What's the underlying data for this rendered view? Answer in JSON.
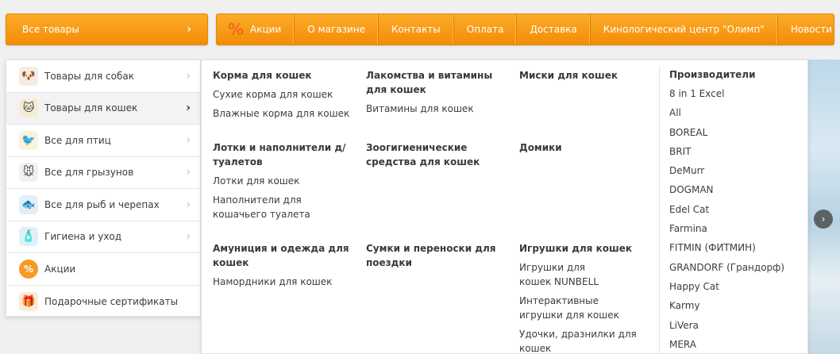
{
  "all_goods": {
    "label": "Все товары",
    "chevron": "›"
  },
  "topnav": {
    "percent_icon": "%",
    "items": [
      "Акции",
      "О магазине",
      "Контакты",
      "Оплата",
      "Доставка",
      "Кинологический центр \"Олимп\"",
      "Новости"
    ]
  },
  "sidebar": {
    "items": [
      {
        "label": "Товары для собак",
        "icon": "dog-icon",
        "glyph": "🐶"
      },
      {
        "label": "Товары для кошек",
        "icon": "cat-icon",
        "glyph": "🐱"
      },
      {
        "label": "Все для птиц",
        "icon": "bird-icon",
        "glyph": "🐦"
      },
      {
        "label": "Все для грызунов",
        "icon": "rodent-icon",
        "glyph": "🐭"
      },
      {
        "label": "Все для рыб и черепах",
        "icon": "fish-icon",
        "glyph": "🐟"
      },
      {
        "label": "Гигиена и уход",
        "icon": "shampoo-icon",
        "glyph": "🧴"
      },
      {
        "label": "Акции",
        "icon": "percent-icon",
        "glyph": "%"
      },
      {
        "label": "Подарочные сертификаты",
        "icon": "gift-certificate-icon",
        "glyph": "🎁"
      }
    ],
    "chevron": "›"
  },
  "mega": {
    "col1": {
      "g1": {
        "title": "Корма для кошек",
        "links": [
          "Сухие корма для кошек",
          "Влажные корма для кошек"
        ]
      },
      "g2": {
        "title": "Лотки и наполнители д/ туалетов",
        "links": [
          "Лотки для кошек",
          "Наполнители для кошачьего туалета"
        ]
      },
      "g3": {
        "title": "Амуниция и одежда для кошек",
        "links": [
          "Намордники для кошек"
        ]
      }
    },
    "col2": {
      "g1": {
        "title": "Лакомства и витамины для кошек",
        "links": [
          "Витамины для кошек"
        ]
      },
      "g2": {
        "title": "Зоогигиенические средства для кошек"
      },
      "g3": {
        "title": "Сумки и переноски для поездки"
      }
    },
    "col3": {
      "g1": {
        "title": "Миски для кошек"
      },
      "g2": {
        "title": "Домики"
      },
      "g3": {
        "title": "Игрушки для кошек",
        "links": [
          "Игрушки для кошек NUNBELL",
          "Интерактивные игрушки для кошек",
          "Удочки, дразнилки для кошек"
        ]
      }
    },
    "brands": {
      "title": "Производители",
      "items": [
        "8 in 1 Excel",
        "All",
        "BOREAL",
        "BRIT",
        "DeMurr",
        "DOGMAN",
        "Edel Cat",
        "Farmina",
        "FITMIN (ФИТМИН)",
        "GRANDORF (Грандорф)",
        "Happy Cat",
        "Karmy",
        "LiVera",
        "MERA"
      ]
    }
  },
  "slider_arrow": "›",
  "colors": {
    "accent": "#f7a01a",
    "accent_dark": "#f38c06",
    "text": "#3c3c3c"
  }
}
